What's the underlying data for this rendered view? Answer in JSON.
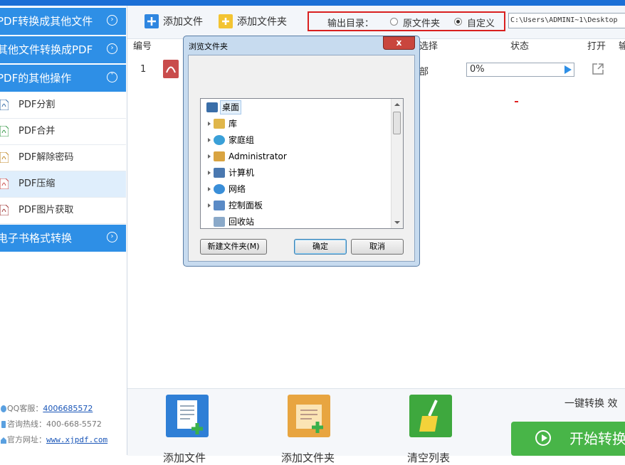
{
  "sidebar": {
    "categories": [
      {
        "label": "PDF转换成其他文件",
        "icon": "chevron-right-circle-icon"
      },
      {
        "label": "其他文件转换成PDF",
        "icon": "chevron-right-circle-icon"
      },
      {
        "label": "PDF的其他操作",
        "icon": "chevron-down-circle-icon"
      },
      {
        "label": "电子书格式转换",
        "icon": "chevron-right-circle-icon"
      }
    ],
    "items": [
      {
        "label": "PDF分割"
      },
      {
        "label": "PDF合并"
      },
      {
        "label": "PDF解除密码"
      },
      {
        "label": "PDF压缩"
      },
      {
        "label": "PDF图片获取"
      }
    ],
    "footer": {
      "qq_label": "QQ客服：",
      "qq_value": "4006685572",
      "hotline_label": "咨询热线：",
      "hotline_value": "400-668-5572",
      "site_label": "官方网址：",
      "site_value": "www.xjpdf.com"
    }
  },
  "toolbar": {
    "add_file": "添加文件",
    "add_folder": "添加文件夹",
    "output_label": "输出目录：",
    "radio_original": "原文件夹",
    "radio_custom": "自定义",
    "path_value": "C:\\Users\\ADMINI~1\\Desktop"
  },
  "table": {
    "headers": {
      "num": "编号",
      "select": "选择",
      "status": "状态",
      "open": "打开",
      "extra": "输"
    },
    "rows": [
      {
        "num": "1",
        "option": "部",
        "progress": "0%"
      }
    ]
  },
  "bottombar": {
    "add_file": "添加文件",
    "add_folder": "添加文件夹",
    "clear_list": "清空列表",
    "one_key": "一键转换  效",
    "start": "开始转换"
  },
  "dialog": {
    "title": "浏览文件夹",
    "close": "x",
    "tree": [
      {
        "label": "桌面",
        "icon": "desktop-icon",
        "color": "#3a6ea8"
      },
      {
        "label": "库",
        "icon": "library-icon",
        "color": "#e0b64a"
      },
      {
        "label": "家庭组",
        "icon": "homegroup-icon",
        "color": "#3aa0d8"
      },
      {
        "label": "Administrator",
        "icon": "user-icon",
        "color": "#d9a441"
      },
      {
        "label": "计算机",
        "icon": "computer-icon",
        "color": "#4a78b0"
      },
      {
        "label": "网络",
        "icon": "network-icon",
        "color": "#3a8ed8"
      },
      {
        "label": "控制面板",
        "icon": "control-panel-icon",
        "color": "#5a8ac6"
      },
      {
        "label": "回收站",
        "icon": "recycle-bin-icon",
        "color": "#8aa9c9"
      }
    ],
    "new_folder": "新建文件夹(M)",
    "ok": "确定",
    "cancel": "取消"
  },
  "colors": {
    "sidebar_category": "#2e8fe6",
    "accent_red": "#d9201f",
    "start_green": "#48b548"
  }
}
